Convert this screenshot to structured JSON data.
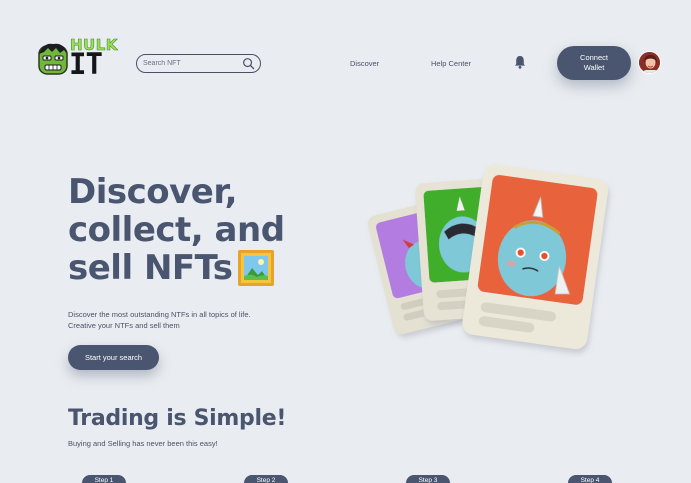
{
  "logo": {
    "top_text": "HULK",
    "bottom_text": "IT"
  },
  "search": {
    "placeholder": "Search NFT"
  },
  "nav": {
    "discover": "Discover",
    "help_center": "Help Center"
  },
  "header": {
    "connect_line1": "Connect",
    "connect_line2": "Wallet"
  },
  "hero": {
    "title_line1": "Discover,",
    "title_line2": "collect, and",
    "title_line3": "sell NFTs",
    "desc_line1": "Discover the most outstanding NTFs in all topics of life.",
    "desc_line2": "Creative your NTFs and sell them",
    "cta": "Start your search"
  },
  "trading": {
    "title": "Trading is Simple!",
    "subtitle": "Buying and Selling has never been this easy!",
    "steps": [
      "Step 1",
      "Step 2",
      "Step 3",
      "Step 4"
    ]
  },
  "colors": {
    "primary": "#4a5570",
    "background": "#e9edf1",
    "card_orange": "#e8623a",
    "card_green": "#3fae2a",
    "card_purple": "#b27be0"
  },
  "icons": {
    "search": "search-icon",
    "bell": "bell-icon",
    "picture": "framed-picture-icon"
  }
}
